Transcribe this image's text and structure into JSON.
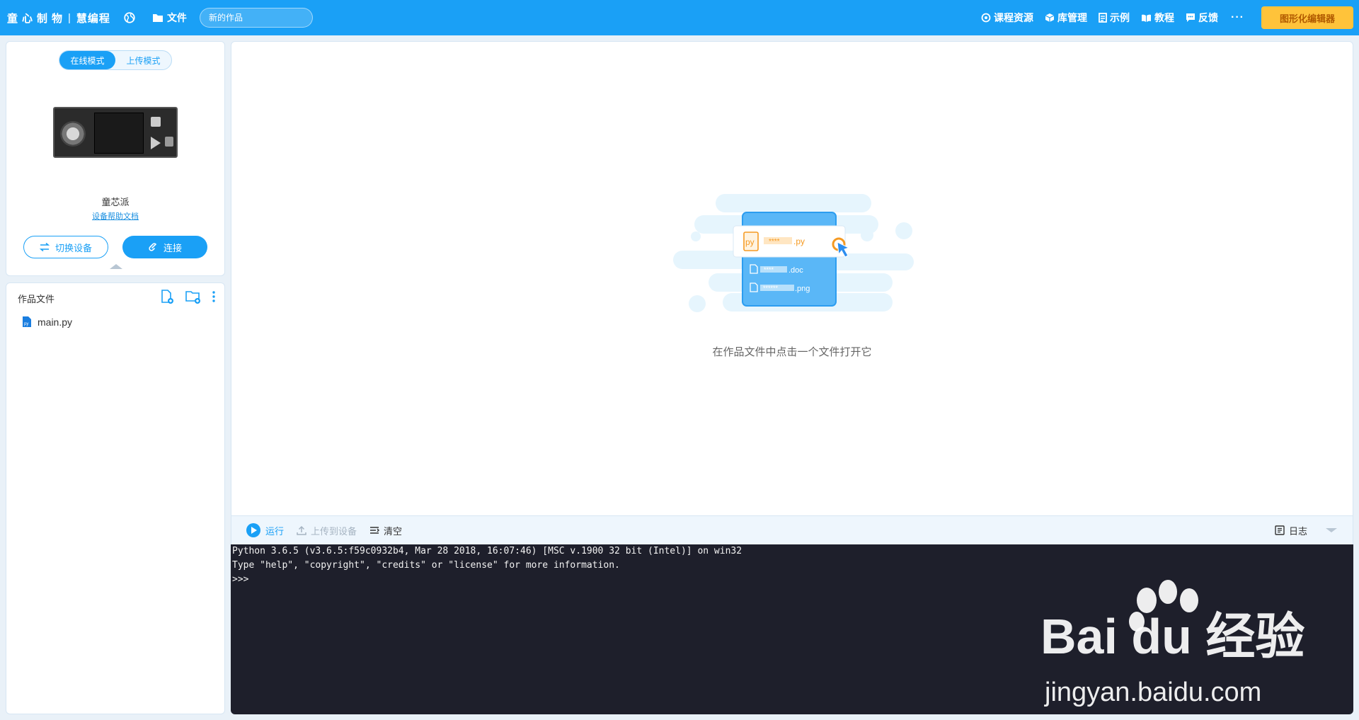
{
  "topbar": {
    "brand": "童心制物",
    "brand_sub": "慧编程",
    "separator": "|",
    "file_menu": "文件",
    "project_name_placeholder": "新的作品",
    "nav": [
      {
        "label": "课程资源",
        "icon": "course-icon"
      },
      {
        "label": "库管理",
        "icon": "library-icon"
      },
      {
        "label": "示例",
        "icon": "example-icon"
      },
      {
        "label": "教程",
        "icon": "tutorial-icon"
      },
      {
        "label": "反馈",
        "icon": "feedback-icon"
      }
    ],
    "more": "···",
    "graphic_editor": "图形化编辑器"
  },
  "device": {
    "mode_online": "在线模式",
    "mode_upload": "上传模式",
    "name": "童芯派",
    "help_link": "设备帮助文档",
    "switch_button": "切换设备",
    "connect_button": "连接"
  },
  "files": {
    "title": "作品文件",
    "items": [
      {
        "name": "main.py"
      }
    ]
  },
  "editor": {
    "empty_hint": "在作品文件中点击一个文件打开它",
    "illustration": {
      "py_label": "****",
      "py_ext": ".py",
      "doc_label": "****",
      "doc_ext": ".doc",
      "png_label": "******",
      "png_ext": ".png",
      "py_badge": "py"
    }
  },
  "console": {
    "run": "运行",
    "upload": "上传到设备",
    "clear": "清空",
    "log": "日志",
    "lines": [
      "Python 3.6.5 (v3.6.5:f59c0932b4, Mar 28 2018, 16:07:46) [MSC v.1900 32 bit (Intel)] on win32",
      "Type \"help\", \"copyright\", \"credits\" or \"license\" for more information.",
      ">>>"
    ]
  },
  "watermark": {
    "brand": "Bai du 经验",
    "url": "jingyan.baidu.com"
  },
  "colors": {
    "primary": "#1aa0f6",
    "graphic_button": "#ffc33a",
    "console_bg": "#1e1f2b",
    "accent_orange": "#f59a23"
  }
}
